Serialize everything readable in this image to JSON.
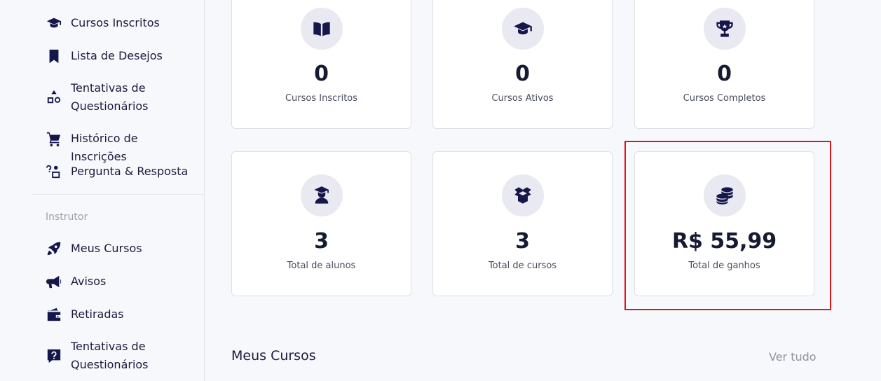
{
  "sidebar": {
    "student_items": [
      {
        "label": "Cursos Inscritos",
        "icon": "graduation-cap-icon"
      },
      {
        "label": "Lista de Desejos",
        "icon": "bookmark-icon"
      },
      {
        "label": "Tentativas de Questionários",
        "icon": "shapes-icon"
      },
      {
        "label": "Histórico de Inscrições",
        "icon": "cart-icon"
      },
      {
        "label": "Pergunta & Resposta",
        "icon": "question-person-icon"
      }
    ],
    "instructor_label": "Instrutor",
    "instructor_items": [
      {
        "label": "Meus Cursos",
        "icon": "rocket-icon"
      },
      {
        "label": "Avisos",
        "icon": "megaphone-icon"
      },
      {
        "label": "Retiradas",
        "icon": "wallet-icon"
      },
      {
        "label": "Tentativas de Questionários",
        "icon": "question-box-icon"
      }
    ]
  },
  "stats": [
    {
      "value": "0",
      "label": "Cursos Inscritos",
      "icon": "book-icon"
    },
    {
      "value": "0",
      "label": "Cursos Ativos",
      "icon": "graduation-cap-icon"
    },
    {
      "value": "0",
      "label": "Cursos Completos",
      "icon": "trophy-icon"
    },
    {
      "value": "3",
      "label": "Total de alunos",
      "icon": "student-icon"
    },
    {
      "value": "3",
      "label": "Total de cursos",
      "icon": "box-icon"
    },
    {
      "value": "R$ 55,99",
      "label": "Total de ganhos",
      "icon": "coins-icon"
    }
  ],
  "main": {
    "section_title": "Meus Cursos",
    "see_all": "Ver tudo"
  },
  "colors": {
    "icon": "#15164a",
    "highlight": "#e0151b",
    "icon_circle": "#e9e9f1"
  }
}
